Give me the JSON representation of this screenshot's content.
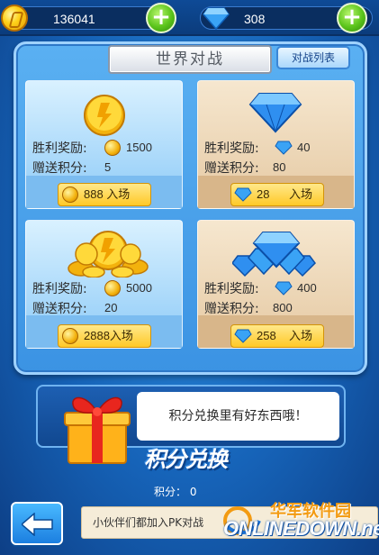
{
  "resources": {
    "coins": "136041",
    "gems": "308"
  },
  "panel": {
    "title": "世界对战",
    "list_button": "对战列表"
  },
  "rooms": [
    {
      "reward_label": "胜利奖励:",
      "reward_value": "1500",
      "points_label": "赠送积分:",
      "points_value": "5",
      "entry_text": "888 入场"
    },
    {
      "reward_label": "胜利奖励:",
      "reward_value": "40",
      "points_label": "赠送积分:",
      "points_value": "80",
      "entry_value": "28",
      "entry_suffix": "入场"
    },
    {
      "reward_label": "胜利奖励:",
      "reward_value": "5000",
      "points_label": "赠送积分:",
      "points_value": "20",
      "entry_text": "2888入场"
    },
    {
      "reward_label": "胜利奖励:",
      "reward_value": "400",
      "points_label": "赠送积分:",
      "points_value": "800",
      "entry_value": "258",
      "entry_suffix": "入场"
    }
  ],
  "exchange": {
    "message": "积分兑换里有好东西哦！",
    "title": "积分兑换",
    "points": "积分：  0"
  },
  "ticker": "小伙伴们都加入PK对战",
  "watermark": {
    "cn": "华军软件园",
    "en": "ONLINEDOWN.net"
  },
  "colors": {
    "accent_blue": "#1663b8",
    "gold": "#ffc928",
    "green_plus": "#5bc41b"
  }
}
